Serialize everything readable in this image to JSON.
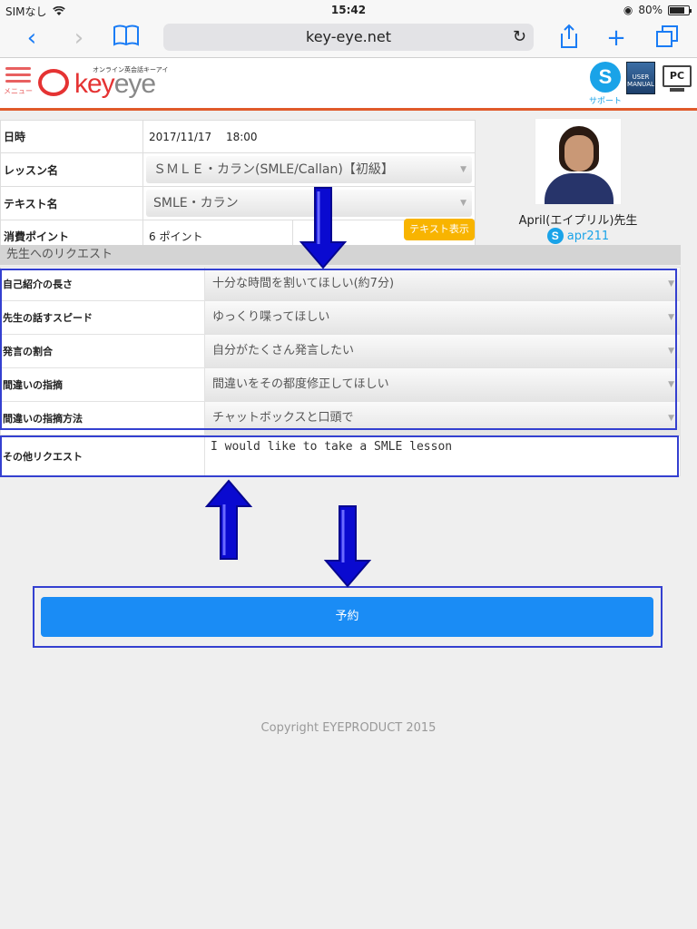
{
  "status_bar": {
    "carrier": "SIMなし",
    "time": "15:42",
    "battery": "80%",
    "battery_level": 0.8
  },
  "browser": {
    "url": "key-eye.net"
  },
  "site": {
    "menu_label": "メニュー",
    "logo_tagline": "オンライン英会話キーアイ",
    "logo_key": "key",
    "logo_eye": "eye",
    "support_label": "サポート",
    "manual_label": "USER MANUAL",
    "pc_label": "PC"
  },
  "lesson": {
    "date_label": "日時",
    "date_value": "2017/11/17　 18:00",
    "lesson_label": "レッスン名",
    "lesson_value": "ＳＭＬＥ・カラン(SMLE/Callan)【初級】",
    "text_label": "テキスト名",
    "text_value": "SMLE・カラン",
    "points_label": "消費ポイント",
    "points_value": "6 ポイント",
    "text_button": "テキスト表示"
  },
  "teacher": {
    "name": "April(エイプリル)先生",
    "skype_id": "apr211"
  },
  "request": {
    "header": "先生へのリクエスト",
    "rows": [
      {
        "label": "自己紹介の長さ",
        "value": "十分な時間を割いてほしい(約7分)"
      },
      {
        "label": "先生の話すスピード",
        "value": "ゆっくり喋ってほしい"
      },
      {
        "label": "発言の割合",
        "value": "自分がたくさん発言したい"
      },
      {
        "label": "間違いの指摘",
        "value": "間違いをその都度修正してほしい"
      },
      {
        "label": "間違いの指摘方法",
        "value": "チャットボックスと口頭で"
      }
    ],
    "other_label": "その他リクエスト",
    "other_value": "I would like to take a SMLE lesson"
  },
  "reserve_button": "予約",
  "copyright": "Copyright EYEPRODUCT 2015",
  "colors": {
    "accent_blue": "#1a8cf5",
    "annotation": "#3440d0",
    "arrow": "#0a0ad0",
    "orange": "#f8b400",
    "brand_red": "#e53333"
  }
}
